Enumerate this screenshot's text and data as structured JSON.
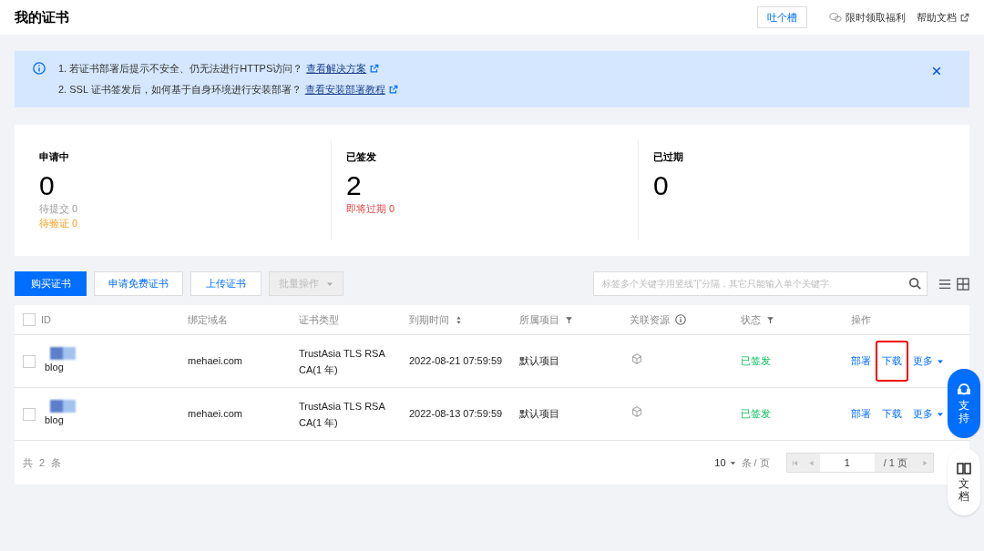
{
  "header": {
    "title": "我的证书",
    "feedback_button": "吐个槽",
    "links": [
      {
        "kind": "wechat",
        "label": "限时领取福利"
      },
      {
        "kind": "external",
        "label": "帮助文档"
      }
    ]
  },
  "notice": {
    "lines": [
      {
        "text": "1. 若证书部署后提示不安全、仍无法进行HTTPS访问？",
        "link": "查看解决方案"
      },
      {
        "text": "2. SSL 证书签发后，如何基于自身环境进行安装部署？",
        "link": "查看安装部署教程"
      }
    ]
  },
  "stats": [
    {
      "title": "申请中",
      "value": "0",
      "details": [
        {
          "text": "待提交 0",
          "kind": "muted"
        },
        {
          "text": "待验证 0",
          "kind": "warning"
        }
      ]
    },
    {
      "title": "已签发",
      "value": "2",
      "details": [
        {
          "text": "即将过期 0",
          "kind": "danger"
        }
      ]
    },
    {
      "title": "已过期",
      "value": "0"
    }
  ],
  "toolbar": {
    "buttons": [
      {
        "label": "购买证书",
        "kind": "primary",
        "disabled": false
      },
      {
        "label": "申请免费证书",
        "kind": "default",
        "disabled": false
      },
      {
        "label": "上传证书",
        "kind": "default",
        "disabled": false
      },
      {
        "label": "批量操作",
        "kind": "dropdown",
        "disabled": true
      }
    ],
    "search": {
      "placeholder": "标签多个关键字用竖线“|”分隔，其它只能输入单个关键字"
    }
  },
  "table": {
    "select_all": {
      "checked": false
    },
    "columns": [
      {
        "label": "ID"
      },
      {
        "label": "绑定域名"
      },
      {
        "label": "证书类型"
      },
      {
        "label": "到期时间"
      },
      {
        "label": "所属项目"
      },
      {
        "label": "关联资源"
      },
      {
        "label": "状态"
      },
      {
        "label": "操作"
      }
    ],
    "rows": [
      {
        "checked": false,
        "id": "blog",
        "domain": "mehaei.com",
        "type": "TrustAsia TLS RSA CA(1 年)",
        "expires": "2022-08-21 07:59:59",
        "project": "默认项目",
        "status": "已签发",
        "actions": [
          {
            "label": "部署",
            "highlighted": false
          },
          {
            "label": "下载",
            "highlighted": true
          },
          {
            "label": "更多",
            "highlighted": false
          }
        ]
      },
      {
        "checked": false,
        "id": "blog",
        "domain": "mehaei.com",
        "type": "TrustAsia TLS RSA CA(1 年)",
        "expires": "2022-08-13 07:59:59",
        "project": "默认项目",
        "status": "已签发",
        "actions": [
          {
            "label": "部署",
            "highlighted": false
          },
          {
            "label": "下载",
            "highlighted": false
          },
          {
            "label": "更多",
            "highlighted": false
          }
        ]
      }
    ]
  },
  "footer": {
    "total": "共 2 条",
    "page_size": "10",
    "page_size_unit": "条 / 页",
    "page": "1",
    "page_total": "/ 1 页"
  },
  "floating": [
    {
      "kind": "support",
      "label": "支持"
    },
    {
      "kind": "docs",
      "label": "文档"
    }
  ]
}
